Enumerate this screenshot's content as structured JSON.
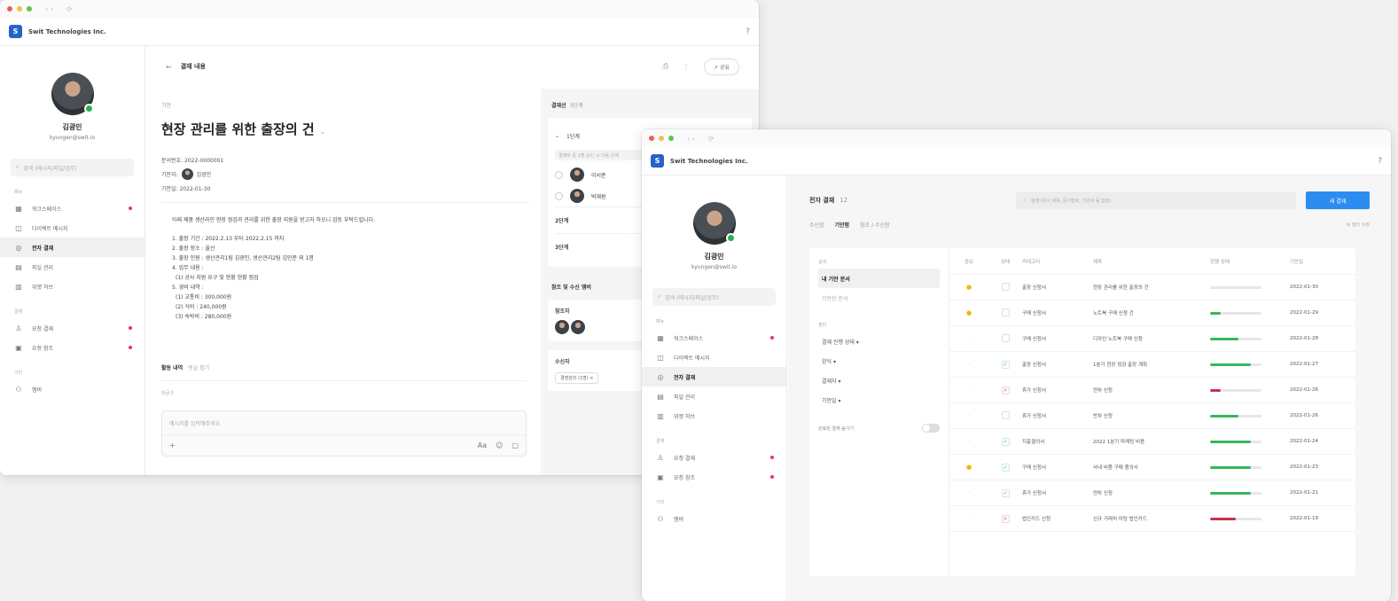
{
  "windows": {
    "company": "Swit Technologies Inc.",
    "logo_letter": "S"
  },
  "user": {
    "name": "김광민",
    "email": "kyungen@swit.io"
  },
  "sidebar": {
    "search_placeholder": "검색 (메시지/파일/업무)",
    "section_main": "메뉴",
    "section_approval": "결재",
    "section_etc": "기타",
    "items": [
      {
        "label": "워크스페이스",
        "icon": "grid-icon",
        "badge": true
      },
      {
        "label": "다이렉트 메시지",
        "icon": "chat-icon",
        "badge": false
      },
      {
        "label": "전자 결재",
        "icon": "approval-icon",
        "badge": false,
        "active": true
      },
      {
        "label": "파일 관리",
        "icon": "file-icon",
        "badge": false
      },
      {
        "label": "위젯 허브",
        "icon": "widget-icon",
        "badge": false
      }
    ],
    "approval_items": [
      {
        "label": "요청 결재",
        "badge": true
      },
      {
        "label": "요청 참조",
        "badge": true
      }
    ],
    "etc_items": [
      {
        "label": "멤버"
      }
    ]
  },
  "detail": {
    "header_title": "결재 내용",
    "share_label": "공유",
    "tag": "기안",
    "title": "현장 관리를 위한 출장의 건",
    "doc_no": "문서번호: 2022-0000001",
    "drafter_label": "기안자:",
    "drafter_name": "김광민",
    "date": "기안일: 2022-01-30",
    "intro": "아래 제품 생산라인 현장 점검과 관리를 위한 출장 지원을 받고자 하오니 검토 부탁드립니다.",
    "lines": [
      "1. 출장 기간 : 2022.2.13 부터 2022.2.15 까지",
      "2. 출장 장소 : 울산",
      "3. 출장 인원 : 생산관리1팀 김광민, 생산관리2팀 김민준 외 1명",
      "4. 업무 내용 :",
      "(1) 공사 지원 요구 및 현황 현황 점검",
      "5. 경비 내역 :",
      "(1) 교통비 : 300,000원",
      "(2) 식비 : 240,000원",
      "(3) 숙박비 : 280,000원"
    ],
    "comments_title": "활동 내역",
    "comments_toggle": "댓글 접기",
    "comments_sub": "댓글 0",
    "comment_placeholder": "메시지를 입력해주세요",
    "comment_tools_right": [
      "Aa",
      "☺"
    ]
  },
  "approval_side": {
    "title": "결재선",
    "title_count": "3단계",
    "stage1": "1단계",
    "stage1_note": "결재자 중 1명 승인 시 다음 단계",
    "approvers": [
      "이서준",
      "박재원"
    ],
    "stage2": "2단계",
    "stage3": "3단계",
    "ref_title": "참조 및 수신 멤버",
    "ref_label": "참조자",
    "receivers_label": "수신자",
    "receiver_pill": "경영관리 (1명)"
  },
  "list": {
    "page_title": "전자 결재",
    "page_count": "12",
    "search_placeholder": "검색 (문서 제목, 문서번호, 기안자 등 입력)",
    "new_button": "새 결재",
    "tabs": [
      "수신함",
      "기안함",
      "참조 / 수신함"
    ],
    "active_tab": 1,
    "tabs_right": "필터 수정",
    "filter_section1": "검색",
    "filter_items": [
      "내 기안 문서",
      "기안한 문서"
    ],
    "filter_section2": "필터",
    "filter_opts": [
      "결재 진행 상태 ▾",
      "양식 ▾",
      "결재자 ▾",
      "기안일 ▾"
    ],
    "toggle_label": "완료된 결재 숨기기",
    "columns": [
      "중요",
      "상태",
      "카테고리",
      "제목",
      "진행 상태",
      "기안일"
    ],
    "rows": [
      {
        "star": true,
        "status": "none",
        "cat": "출장 신청서",
        "title": "현장 관리를 위한 출장의 건",
        "progress": 0.0,
        "color": "#cccccc",
        "date": "2022-01-30"
      },
      {
        "star": true,
        "status": "none",
        "cat": "구매 신청서",
        "title": "노트북 구매 신청 건",
        "progress": 0.2,
        "color": "#3ab65a",
        "date": "2022-01-29"
      },
      {
        "star": false,
        "status": "none",
        "cat": "구매 신청서",
        "title": "디자인 노트북 구매 신청",
        "progress": 0.55,
        "color": "#3ab65a",
        "date": "2022-01-28"
      },
      {
        "star": false,
        "status": "ok",
        "cat": "출장 신청서",
        "title": "1분기 현장 점검 출장 계획",
        "progress": 0.8,
        "color": "#3ab65a",
        "date": "2022-01-27"
      },
      {
        "star": false,
        "status": "no",
        "cat": "휴가 신청서",
        "title": "연차 신청",
        "progress": 0.2,
        "color": "#c8324a",
        "date": "2022-01-26"
      },
      {
        "star": false,
        "status": "none",
        "cat": "휴가 신청서",
        "title": "반차 신청",
        "progress": 0.55,
        "color": "#3ab65a",
        "date": "2022-01-26"
      },
      {
        "star": false,
        "status": "ok",
        "cat": "지출결의서",
        "title": "2022 1분기 마케팅 비용",
        "progress": 0.8,
        "color": "#3ab65a",
        "date": "2022-01-24"
      },
      {
        "star": true,
        "status": "ok",
        "cat": "구매 신청서",
        "title": "사내 비품 구매 품의서",
        "progress": 0.8,
        "color": "#3ab65a",
        "date": "2022-01-23"
      },
      {
        "star": false,
        "status": "ok",
        "cat": "휴가 신청서",
        "title": "연차 신청",
        "progress": 0.8,
        "color": "#3ab65a",
        "date": "2022-01-21"
      },
      {
        "star": false,
        "status": "no",
        "cat": "법인카드 신청",
        "title": "신규 거래처 미팅 법인카드",
        "progress": 0.5,
        "color": "#c8324a",
        "date": "2022-01-19"
      }
    ]
  }
}
